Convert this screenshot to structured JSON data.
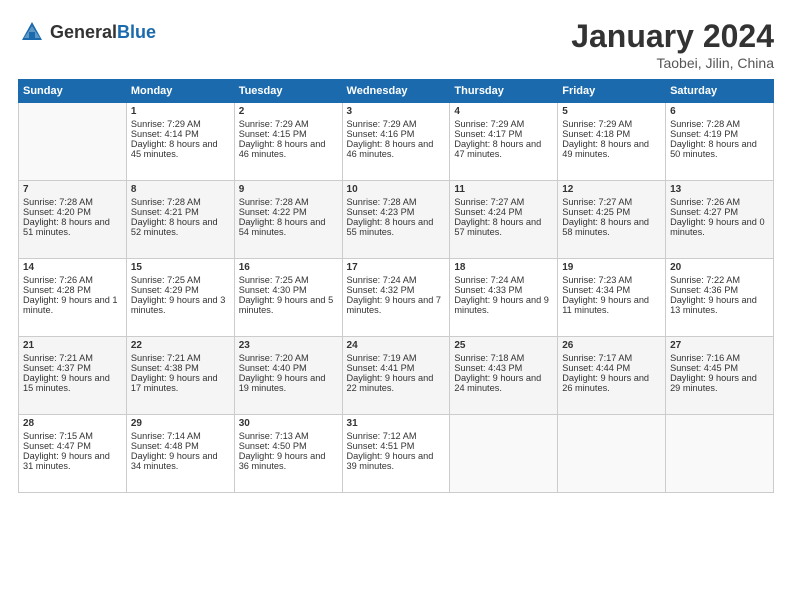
{
  "header": {
    "logo_general": "General",
    "logo_blue": "Blue",
    "month": "January 2024",
    "location": "Taobei, Jilin, China"
  },
  "weekdays": [
    "Sunday",
    "Monday",
    "Tuesday",
    "Wednesday",
    "Thursday",
    "Friday",
    "Saturday"
  ],
  "weeks": [
    [
      {
        "day": "",
        "sunrise": "",
        "sunset": "",
        "daylight": ""
      },
      {
        "day": "1",
        "sunrise": "Sunrise: 7:29 AM",
        "sunset": "Sunset: 4:14 PM",
        "daylight": "Daylight: 8 hours and 45 minutes."
      },
      {
        "day": "2",
        "sunrise": "Sunrise: 7:29 AM",
        "sunset": "Sunset: 4:15 PM",
        "daylight": "Daylight: 8 hours and 46 minutes."
      },
      {
        "day": "3",
        "sunrise": "Sunrise: 7:29 AM",
        "sunset": "Sunset: 4:16 PM",
        "daylight": "Daylight: 8 hours and 46 minutes."
      },
      {
        "day": "4",
        "sunrise": "Sunrise: 7:29 AM",
        "sunset": "Sunset: 4:17 PM",
        "daylight": "Daylight: 8 hours and 47 minutes."
      },
      {
        "day": "5",
        "sunrise": "Sunrise: 7:29 AM",
        "sunset": "Sunset: 4:18 PM",
        "daylight": "Daylight: 8 hours and 49 minutes."
      },
      {
        "day": "6",
        "sunrise": "Sunrise: 7:28 AM",
        "sunset": "Sunset: 4:19 PM",
        "daylight": "Daylight: 8 hours and 50 minutes."
      }
    ],
    [
      {
        "day": "7",
        "sunrise": "Sunrise: 7:28 AM",
        "sunset": "Sunset: 4:20 PM",
        "daylight": "Daylight: 8 hours and 51 minutes."
      },
      {
        "day": "8",
        "sunrise": "Sunrise: 7:28 AM",
        "sunset": "Sunset: 4:21 PM",
        "daylight": "Daylight: 8 hours and 52 minutes."
      },
      {
        "day": "9",
        "sunrise": "Sunrise: 7:28 AM",
        "sunset": "Sunset: 4:22 PM",
        "daylight": "Daylight: 8 hours and 54 minutes."
      },
      {
        "day": "10",
        "sunrise": "Sunrise: 7:28 AM",
        "sunset": "Sunset: 4:23 PM",
        "daylight": "Daylight: 8 hours and 55 minutes."
      },
      {
        "day": "11",
        "sunrise": "Sunrise: 7:27 AM",
        "sunset": "Sunset: 4:24 PM",
        "daylight": "Daylight: 8 hours and 57 minutes."
      },
      {
        "day": "12",
        "sunrise": "Sunrise: 7:27 AM",
        "sunset": "Sunset: 4:25 PM",
        "daylight": "Daylight: 8 hours and 58 minutes."
      },
      {
        "day": "13",
        "sunrise": "Sunrise: 7:26 AM",
        "sunset": "Sunset: 4:27 PM",
        "daylight": "Daylight: 9 hours and 0 minutes."
      }
    ],
    [
      {
        "day": "14",
        "sunrise": "Sunrise: 7:26 AM",
        "sunset": "Sunset: 4:28 PM",
        "daylight": "Daylight: 9 hours and 1 minute."
      },
      {
        "day": "15",
        "sunrise": "Sunrise: 7:25 AM",
        "sunset": "Sunset: 4:29 PM",
        "daylight": "Daylight: 9 hours and 3 minutes."
      },
      {
        "day": "16",
        "sunrise": "Sunrise: 7:25 AM",
        "sunset": "Sunset: 4:30 PM",
        "daylight": "Daylight: 9 hours and 5 minutes."
      },
      {
        "day": "17",
        "sunrise": "Sunrise: 7:24 AM",
        "sunset": "Sunset: 4:32 PM",
        "daylight": "Daylight: 9 hours and 7 minutes."
      },
      {
        "day": "18",
        "sunrise": "Sunrise: 7:24 AM",
        "sunset": "Sunset: 4:33 PM",
        "daylight": "Daylight: 9 hours and 9 minutes."
      },
      {
        "day": "19",
        "sunrise": "Sunrise: 7:23 AM",
        "sunset": "Sunset: 4:34 PM",
        "daylight": "Daylight: 9 hours and 11 minutes."
      },
      {
        "day": "20",
        "sunrise": "Sunrise: 7:22 AM",
        "sunset": "Sunset: 4:36 PM",
        "daylight": "Daylight: 9 hours and 13 minutes."
      }
    ],
    [
      {
        "day": "21",
        "sunrise": "Sunrise: 7:21 AM",
        "sunset": "Sunset: 4:37 PM",
        "daylight": "Daylight: 9 hours and 15 minutes."
      },
      {
        "day": "22",
        "sunrise": "Sunrise: 7:21 AM",
        "sunset": "Sunset: 4:38 PM",
        "daylight": "Daylight: 9 hours and 17 minutes."
      },
      {
        "day": "23",
        "sunrise": "Sunrise: 7:20 AM",
        "sunset": "Sunset: 4:40 PM",
        "daylight": "Daylight: 9 hours and 19 minutes."
      },
      {
        "day": "24",
        "sunrise": "Sunrise: 7:19 AM",
        "sunset": "Sunset: 4:41 PM",
        "daylight": "Daylight: 9 hours and 22 minutes."
      },
      {
        "day": "25",
        "sunrise": "Sunrise: 7:18 AM",
        "sunset": "Sunset: 4:43 PM",
        "daylight": "Daylight: 9 hours and 24 minutes."
      },
      {
        "day": "26",
        "sunrise": "Sunrise: 7:17 AM",
        "sunset": "Sunset: 4:44 PM",
        "daylight": "Daylight: 9 hours and 26 minutes."
      },
      {
        "day": "27",
        "sunrise": "Sunrise: 7:16 AM",
        "sunset": "Sunset: 4:45 PM",
        "daylight": "Daylight: 9 hours and 29 minutes."
      }
    ],
    [
      {
        "day": "28",
        "sunrise": "Sunrise: 7:15 AM",
        "sunset": "Sunset: 4:47 PM",
        "daylight": "Daylight: 9 hours and 31 minutes."
      },
      {
        "day": "29",
        "sunrise": "Sunrise: 7:14 AM",
        "sunset": "Sunset: 4:48 PM",
        "daylight": "Daylight: 9 hours and 34 minutes."
      },
      {
        "day": "30",
        "sunrise": "Sunrise: 7:13 AM",
        "sunset": "Sunset: 4:50 PM",
        "daylight": "Daylight: 9 hours and 36 minutes."
      },
      {
        "day": "31",
        "sunrise": "Sunrise: 7:12 AM",
        "sunset": "Sunset: 4:51 PM",
        "daylight": "Daylight: 9 hours and 39 minutes."
      },
      {
        "day": "",
        "sunrise": "",
        "sunset": "",
        "daylight": ""
      },
      {
        "day": "",
        "sunrise": "",
        "sunset": "",
        "daylight": ""
      },
      {
        "day": "",
        "sunrise": "",
        "sunset": "",
        "daylight": ""
      }
    ]
  ]
}
